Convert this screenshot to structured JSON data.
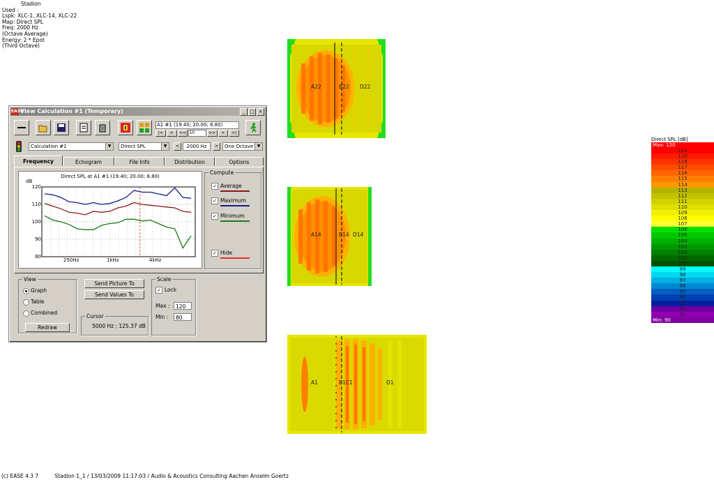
{
  "info": {
    "title": "Stadion",
    "lines": [
      "Used :",
      "Lspk: XLC-1, XLC-14, XLC-22",
      "Map: Direct SPL",
      "Freq: 2000 Hz",
      "(Octave Average)",
      "Energy: 2 * Epot",
      "(Third Octave)"
    ]
  },
  "footer": {
    "copyright": "(c) EASE 4.3  7",
    "text": "Stadion 1_1 / 13/03/2009 11:17:03 / Audio & Acoustics Consulting Aachen Anselm Goertz"
  },
  "window": {
    "logo": "EASE",
    "title": "View Calculation #1 (Temporary)",
    "nav": {
      "position": "A1 #1  (19.40; 20.00; 8.80)",
      "step": "10",
      "buttons": [
        "|<",
        "<",
        "<<",
        ">>",
        ">",
        ">|"
      ]
    },
    "calc_select": "Calculation #1",
    "map_select": "Direct SPL",
    "freq_value": "2000 Hz",
    "band_select": "One Octave",
    "tabs": [
      "Frequency",
      "Echogram",
      "File Info",
      "Distribution",
      "Options"
    ],
    "active_tab": "Frequency",
    "compute": {
      "label": "Compute",
      "items": [
        {
          "label": "Average",
          "checked": true,
          "color": "#8b1a1a"
        },
        {
          "label": "Maximum",
          "checked": true,
          "color": "#1a1a8b"
        },
        {
          "label": "Minimum",
          "checked": true,
          "color": "#1a7a1a"
        },
        {
          "label": "Hide",
          "checked": true,
          "color": "#e03030"
        }
      ]
    },
    "view": {
      "label": "View",
      "options": [
        "Graph",
        "Table",
        "Combined"
      ],
      "selected": "Graph",
      "redraw": "Redraw"
    },
    "send_picture": "Send Picture To",
    "send_values": "Send Values To",
    "cursor": {
      "label": "Cursor",
      "value": "5000 Hz ; 125.37 dB"
    },
    "scale": {
      "label": "Scale",
      "lock_label": "Lock",
      "lock": true,
      "max_label": "Max :",
      "max": "120",
      "min_label": "Min :",
      "min": "80"
    }
  },
  "chart_data": {
    "type": "line",
    "title": "Direct SPL at A1 #1  (19.40; 20.00; 8.80)",
    "ylabel": "dB",
    "ylim": [
      80,
      120
    ],
    "yticks": [
      "120",
      "110",
      "100",
      "90",
      "80"
    ],
    "xticks": [
      "250Hz",
      "1kHz",
      "4kHz"
    ],
    "cursor_x_fraction": 0.64,
    "series": [
      {
        "name": "Maximum",
        "color": "#1a1a8b",
        "values": [
          116,
          115.5,
          114,
          111.5,
          111,
          110,
          111,
          110,
          110.5,
          112,
          114,
          118,
          117,
          117,
          116,
          115,
          119.5,
          114,
          113.5
        ]
      },
      {
        "name": "Average",
        "color": "#8b1a1a",
        "values": [
          110.5,
          109,
          107.5,
          105.5,
          105,
          104,
          106,
          105.5,
          106,
          108,
          109,
          111,
          110,
          109.5,
          109,
          108.5,
          108,
          106,
          105.5
        ]
      },
      {
        "name": "Minimum",
        "color": "#1a7a1a",
        "values": [
          103.5,
          101,
          100,
          98.5,
          96,
          95.5,
          95.5,
          98,
          99,
          99.5,
          101.5,
          101.5,
          100.5,
          101,
          99,
          97,
          96,
          85,
          92
        ]
      }
    ]
  },
  "maps": [
    {
      "labels": [
        "A22",
        "B22",
        "D22"
      ]
    },
    {
      "labels": [
        "A14",
        "B14",
        "D14"
      ]
    },
    {
      "labels": [
        "A1",
        "B1C1",
        "D1"
      ]
    }
  ],
  "legend": {
    "title": "Direct SPL [dB]",
    "max": "Max:  120",
    "min": "Min:  90",
    "rows": [
      {
        "label": "120",
        "color": "#ff0000"
      },
      {
        "label": "119",
        "color": "#ff1a00"
      },
      {
        "label": "118",
        "color": "#ff3300"
      },
      {
        "label": "117",
        "color": "#ff4d00"
      },
      {
        "label": "116",
        "color": "#ff6600"
      },
      {
        "label": "115",
        "color": "#ff8000"
      },
      {
        "label": "114",
        "color": "#ff9900"
      },
      {
        "label": "113",
        "color": "#b3b300"
      },
      {
        "label": "112",
        "color": "#c2c200"
      },
      {
        "label": "111",
        "color": "#d1d100"
      },
      {
        "label": "110",
        "color": "#e0e000"
      },
      {
        "label": "109",
        "color": "#f0f000"
      },
      {
        "label": "108",
        "color": "#ffff00"
      },
      {
        "label": "107",
        "color": "#ffff33"
      },
      {
        "label": "106",
        "color": "#00e000"
      },
      {
        "label": "105",
        "color": "#00c800"
      },
      {
        "label": "104",
        "color": "#00b000"
      },
      {
        "label": "103",
        "color": "#009800"
      },
      {
        "label": "102",
        "color": "#008000"
      },
      {
        "label": "101",
        "color": "#006800"
      },
      {
        "label": "100",
        "color": "#005000"
      },
      {
        "label": "99",
        "color": "#00ffff"
      },
      {
        "label": "98",
        "color": "#00d8f0"
      },
      {
        "label": "97",
        "color": "#00b0e0"
      },
      {
        "label": "96",
        "color": "#0088d0"
      },
      {
        "label": "95",
        "color": "#0060c0"
      },
      {
        "label": "94",
        "color": "#0040b0"
      },
      {
        "label": "93",
        "color": "#0020a0"
      },
      {
        "label": "92",
        "color": "#7000a0"
      },
      {
        "label": "91",
        "color": "#9000b0"
      }
    ]
  }
}
